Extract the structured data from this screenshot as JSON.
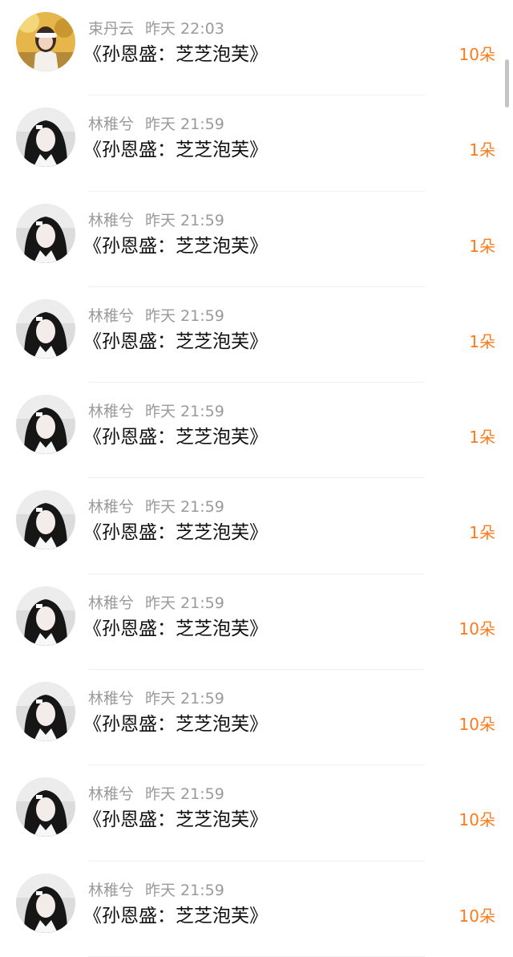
{
  "rows": [
    {
      "name": "束丹云",
      "time": "昨天 22:03",
      "title": "《孙恩盛：芝芝泡芙》",
      "amount": "10朵",
      "avatar": "avatar-yellow"
    },
    {
      "name": "林稚兮",
      "time": "昨天 21:59",
      "title": "《孙恩盛：芝芝泡芙》",
      "amount": "1朵",
      "avatar": "avatar-bw"
    },
    {
      "name": "林稚兮",
      "time": "昨天 21:59",
      "title": "《孙恩盛：芝芝泡芙》",
      "amount": "1朵",
      "avatar": "avatar-bw"
    },
    {
      "name": "林稚兮",
      "time": "昨天 21:59",
      "title": "《孙恩盛：芝芝泡芙》",
      "amount": "1朵",
      "avatar": "avatar-bw"
    },
    {
      "name": "林稚兮",
      "time": "昨天 21:59",
      "title": "《孙恩盛：芝芝泡芙》",
      "amount": "1朵",
      "avatar": "avatar-bw"
    },
    {
      "name": "林稚兮",
      "time": "昨天 21:59",
      "title": "《孙恩盛：芝芝泡芙》",
      "amount": "1朵",
      "avatar": "avatar-bw"
    },
    {
      "name": "林稚兮",
      "time": "昨天 21:59",
      "title": "《孙恩盛：芝芝泡芙》",
      "amount": "10朵",
      "avatar": "avatar-bw"
    },
    {
      "name": "林稚兮",
      "time": "昨天 21:59",
      "title": "《孙恩盛：芝芝泡芙》",
      "amount": "10朵",
      "avatar": "avatar-bw"
    },
    {
      "name": "林稚兮",
      "time": "昨天 21:59",
      "title": "《孙恩盛：芝芝泡芙》",
      "amount": "10朵",
      "avatar": "avatar-bw"
    },
    {
      "name": "林稚兮",
      "time": "昨天 21:59",
      "title": "《孙恩盛：芝芝泡芙》",
      "amount": "10朵",
      "avatar": "avatar-bw"
    }
  ],
  "colors": {
    "amount": "#ff7a1a",
    "meta": "#9a9a9a",
    "title": "#111111"
  }
}
